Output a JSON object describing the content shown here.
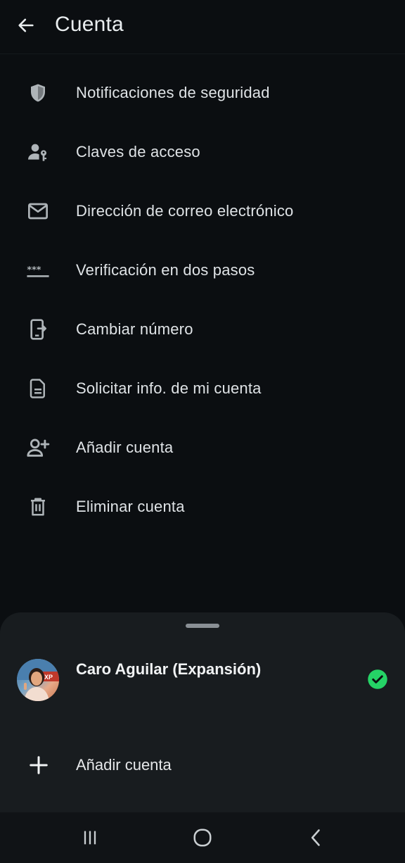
{
  "header": {
    "title": "Cuenta",
    "back_icon": "arrow-left-icon"
  },
  "menu": {
    "items": [
      {
        "label": "Notificaciones de seguridad",
        "icon": "shield-icon"
      },
      {
        "label": "Claves de acceso",
        "icon": "person-key-icon"
      },
      {
        "label": "Dirección de correo electrónico",
        "icon": "mail-icon"
      },
      {
        "label": "Verificación en dos pasos",
        "icon": "password-dots-icon"
      },
      {
        "label": "Cambiar número",
        "icon": "phone-transfer-icon"
      },
      {
        "label": "Solicitar info. de mi cuenta",
        "icon": "document-icon"
      },
      {
        "label": "Añadir cuenta",
        "icon": "add-person-icon"
      },
      {
        "label": "Eliminar cuenta",
        "icon": "trash-icon"
      }
    ]
  },
  "sheet": {
    "account": {
      "name": "Caro Aguilar (Expansión)",
      "selected": true
    },
    "add_account_label": "Añadir cuenta"
  },
  "colors": {
    "background": "#0b0e11",
    "sheet_background": "#181c1f",
    "accent_green": "#25d366",
    "icon_grey": "#aeb4b8"
  },
  "navbar": {
    "icons": [
      "recent-apps-icon",
      "home-icon",
      "back-icon"
    ]
  }
}
